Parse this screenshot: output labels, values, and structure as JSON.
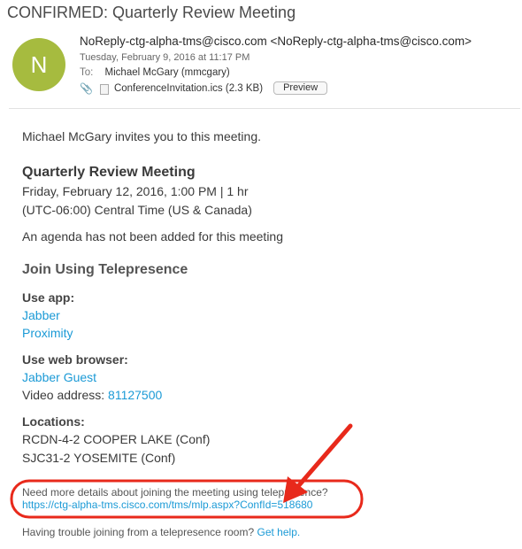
{
  "subject": "CONFIRMED: Quarterly Review Meeting",
  "sender": {
    "avatar_letter": "N",
    "from": "NoReply-ctg-alpha-tms@cisco.com <NoReply-ctg-alpha-tms@cisco.com>",
    "date": "Tuesday, February 9, 2016 at 11:17 PM",
    "to_label": "To:",
    "to": "Michael McGary (mmcgary)",
    "attachment_name": "ConferenceInvitation.ics (2.3 KB)",
    "preview_label": "Preview"
  },
  "body": {
    "invite": "Michael McGary invites you to this meeting.",
    "meeting_title": "Quarterly Review Meeting",
    "meeting_time": "Friday, February 12, 2016, 1:00 PM | 1 hr",
    "timezone": "(UTC-06:00) Central Time (US & Canada)",
    "agenda": "An agenda has not been added for this meeting",
    "join_heading": "Join Using Telepresence",
    "use_app_label": "Use app:",
    "app_links": [
      "Jabber",
      "Proximity"
    ],
    "web_label": "Use web browser:",
    "web_link": "Jabber Guest",
    "video_label": "Video address:",
    "video_address": "81127500",
    "locations_label": "Locations:",
    "locations": [
      "RCDN-4-2 COOPER LAKE (Conf)",
      "SJC31-2 YOSEMITE (Conf)"
    ],
    "details_question": "Need more details about joining the meeting using telepresence?",
    "details_url": "https://ctg-alpha-tms.cisco.com/tms/mlp.aspx?ConfId=518680",
    "trouble_text": "Having trouble joining from a telepresence room?",
    "help_link": "Get help."
  },
  "colors": {
    "avatar": "#a6bb3f",
    "link": "#1b9ad6",
    "annotation": "#e8291b"
  }
}
